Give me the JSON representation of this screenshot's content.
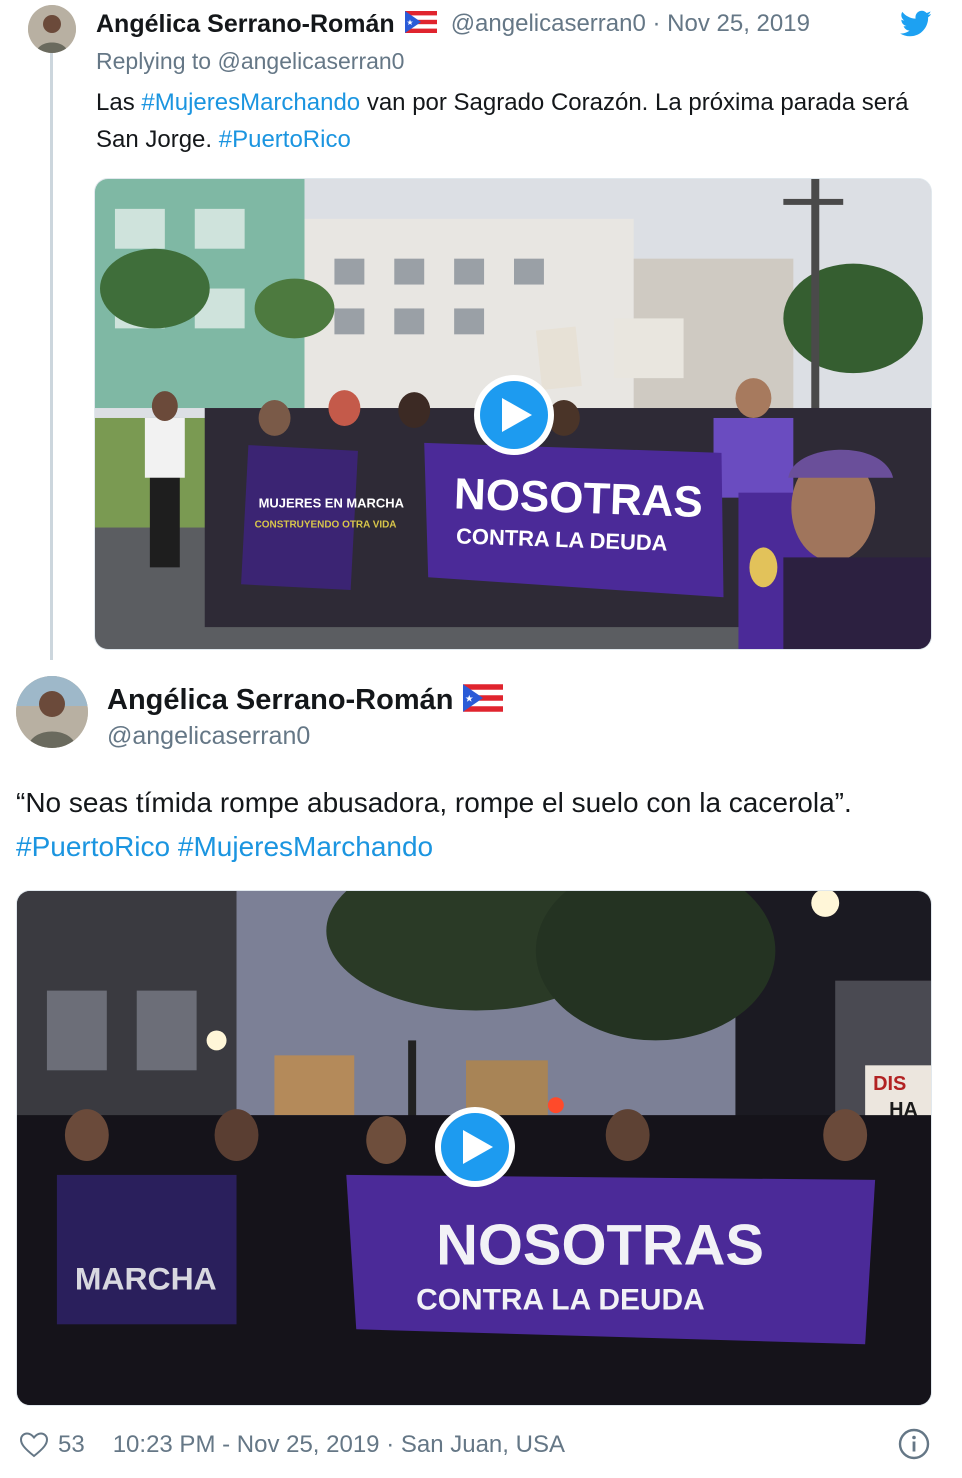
{
  "tweet1": {
    "name": "Angélica Serrano-Román",
    "handle_date": "@angelicaserran0 · Nov 25, 2019",
    "replying_to_prefix": "Replying to ",
    "replying_to_handle": "@angelicaserran0",
    "text_parts": [
      "Las ",
      "#MujeresMarchando",
      " van por Sagrado Corazón. La próxima parada será San Jorge. ",
      "#PuertoRico"
    ],
    "media": {
      "banner_big": "NOSOTRAS",
      "banner_small": "CONTRA LA DEUDA",
      "banner_left_1": "MUJERES EN MARCHA",
      "banner_left_2": "CONSTRUYENDO OTRA VIDA"
    }
  },
  "tweet2": {
    "name": "Angélica Serrano-Román",
    "handle": "@angelicaserran0",
    "text_parts": [
      "“No seas tímida rompe abusadora, rompe el suelo con la cacerola”. ",
      "#PuertoRico",
      " ",
      "#MujeresMarchando"
    ],
    "media": {
      "banner_big": "NOSOTRAS",
      "banner_small": "CONTRA LA DEUDA",
      "banner_left": "MARCHA",
      "sign_right_1": "DIS",
      "sign_right_2": "HA"
    },
    "likes": "53",
    "timestamp_location": "10:23 PM - Nov 25, 2019 · San Juan, USA"
  },
  "colors": {
    "accent": "#1b95e0",
    "secondary_text": "#657786",
    "banner_purple": "#4b2a98"
  },
  "icons": {
    "verified_flag": "puerto-rico-flag-icon",
    "brand": "twitter-bird-icon",
    "like": "heart-icon",
    "info": "info-icon",
    "play": "play-icon"
  }
}
